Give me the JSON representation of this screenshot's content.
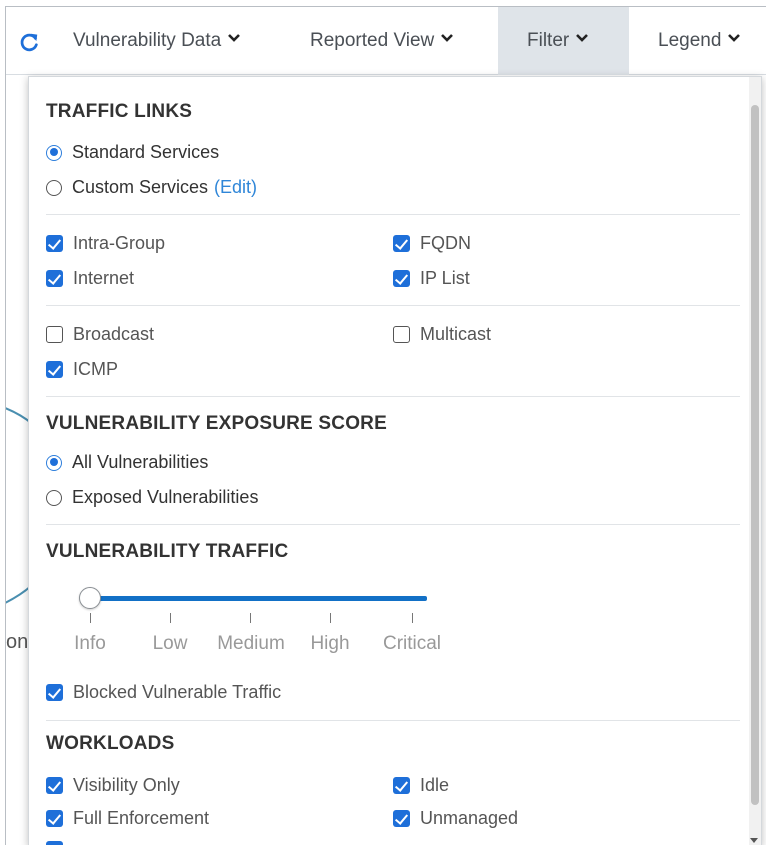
{
  "toolbar": {
    "items": [
      {
        "label": "Vulnerability Data"
      },
      {
        "label": "Reported View"
      },
      {
        "label": "Filter"
      },
      {
        "label": "Legend"
      }
    ]
  },
  "background": {
    "partial_text": "on"
  },
  "panel": {
    "traffic_links": {
      "title": "TRAFFIC LINKS",
      "standard": {
        "label": "Standard Services",
        "checked": true
      },
      "custom": {
        "label": "Custom Services",
        "edit": "(Edit)",
        "checked": false
      },
      "checks": [
        {
          "label": "Intra-Group",
          "checked": true
        },
        {
          "label": "FQDN",
          "checked": true
        },
        {
          "label": "Internet",
          "checked": true
        },
        {
          "label": "IP List",
          "checked": true
        },
        {
          "label": "Broadcast",
          "checked": false
        },
        {
          "label": "Multicast",
          "checked": false
        },
        {
          "label": "ICMP",
          "checked": true
        }
      ]
    },
    "exposure": {
      "title": "VULNERABILITY EXPOSURE SCORE",
      "all": {
        "label": "All Vulnerabilities",
        "checked": true
      },
      "exposed": {
        "label": "Exposed Vulnerabilities",
        "checked": false
      }
    },
    "vuln_traffic": {
      "title": "VULNERABILITY TRAFFIC",
      "slider_levels": [
        "Info",
        "Low",
        "Medium",
        "High",
        "Critical"
      ],
      "slider_value": "Info",
      "blocked": {
        "label": "Blocked Vulnerable Traffic",
        "checked": true
      }
    },
    "workloads": {
      "title": "WORKLOADS",
      "checks": [
        {
          "label": "Visibility Only",
          "checked": true
        },
        {
          "label": "Idle",
          "checked": true
        },
        {
          "label": "Full Enforcement",
          "checked": true
        },
        {
          "label": "Unmanaged",
          "checked": true
        }
      ]
    }
  },
  "colors": {
    "accent": "#1e6fd9",
    "link": "#2f86d8",
    "active_tab": "#dfe4e9"
  }
}
